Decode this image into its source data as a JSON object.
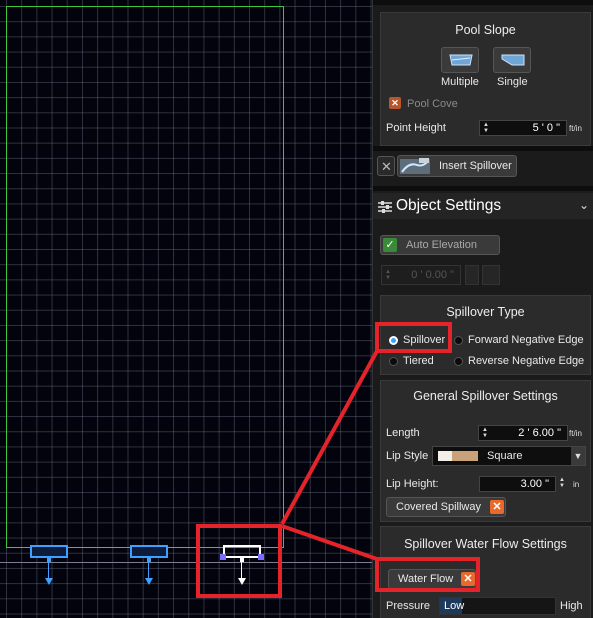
{
  "pool_slope": {
    "title": "Pool Slope",
    "multiple_label": "Multiple",
    "single_label": "Single",
    "pool_cove_label": "Pool Cove",
    "point_height_label": "Point Height",
    "point_height_value": "5 ' 0 \"",
    "point_height_unit": "ft/in"
  },
  "insert_spillover": {
    "label": "Insert Spillover"
  },
  "object_settings": {
    "title": "Object Settings",
    "auto_elevation_label": "Auto Elevation",
    "elevation_value": "0 ' 0.00 \""
  },
  "spillover_type": {
    "title": "Spillover Type",
    "options": [
      "Spillover",
      "Forward Negative Edge",
      "Tiered",
      "Reverse Negative Edge"
    ],
    "selected": "Spillover"
  },
  "general": {
    "title": "General Spillover Settings",
    "length_label": "Length",
    "length_value": "2 ' 6.00 \"",
    "length_unit": "ft/in",
    "lip_style_label": "Lip Style",
    "lip_style_value": "Square",
    "lip_height_label": "Lip Height:",
    "lip_height_value": "3.00 \"",
    "lip_height_unit": "in",
    "covered_spillway_label": "Covered Spillway"
  },
  "water_flow": {
    "title": "Spillover Water Flow Settings",
    "water_flow_label": "Water Flow",
    "pressure_label": "Pressure",
    "low_label": "Low",
    "high_label": "High"
  },
  "colors": {
    "highlight": "#e5232b",
    "accent": "#e8692b",
    "pool_outline": "#3cc83c",
    "spillover_blue": "#3ea0ff"
  }
}
